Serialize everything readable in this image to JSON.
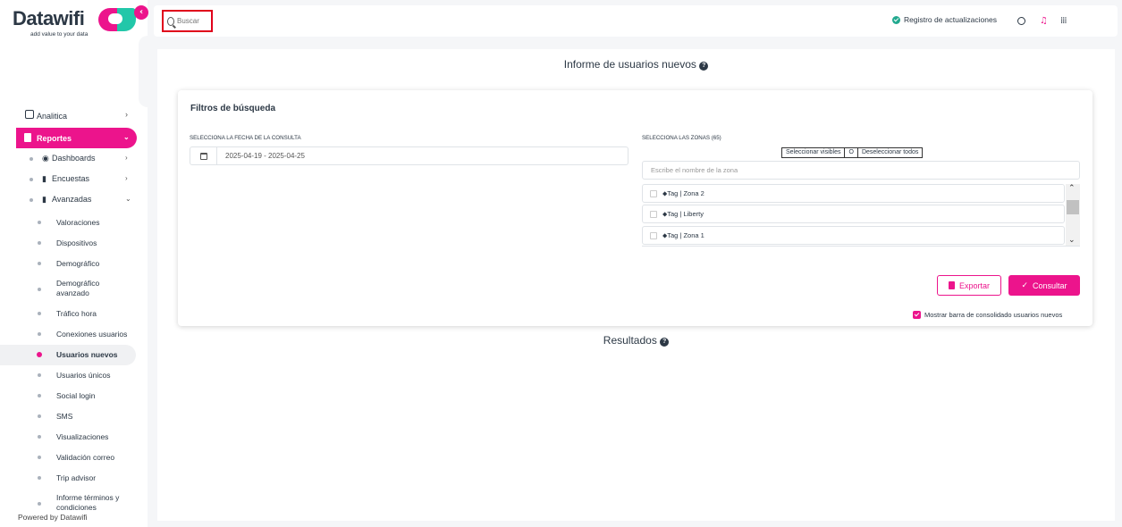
{
  "brand": {
    "name": "Datawifi",
    "tagline": "add value to your data",
    "accent": "#ec148c",
    "teal": "#22c7a9"
  },
  "topbar": {
    "search_placeholder": "Buscar",
    "updates_label": "Registro de actualizaciones",
    "icons": [
      "search-icon",
      "check-circle-icon",
      "globe-icon",
      "bell-icon",
      "apps-grid-icon"
    ]
  },
  "sidebar": {
    "collapse_icon": "chevron-left-icon",
    "top_items": [
      {
        "label": "Analitica",
        "icon": "chart-icon"
      }
    ],
    "reportes": {
      "label": "Reportes",
      "icon": "document-icon"
    },
    "sub_items": [
      {
        "label": "Dashboards",
        "icon": "dashboard-icon"
      },
      {
        "label": "Encuestas",
        "icon": "clipboard-icon"
      },
      {
        "label": "Avanzadas",
        "icon": "bars-icon"
      }
    ],
    "leaves": [
      "Valoraciones",
      "Dispositivos",
      "Demográfico",
      "Demográfico avanzado",
      "Tráfico hora",
      "Conexiones usuarios",
      "Usuarios nuevos",
      "Usuarios únicos",
      "Social login",
      "SMS",
      "Visualizaciones",
      "Validación correo",
      "Trip advisor",
      "Informe términos y condiciones"
    ],
    "current_leaf": "Usuarios nuevos",
    "footer": "Powered by Datawifi"
  },
  "main": {
    "title": "Informe de usuarios nuevos",
    "filters": {
      "title": "Filtros de búsqueda",
      "date_label": "SELECCIONA LA FECHA DE LA CONSULTA",
      "date_value": "2025-04-19 - 2025-04-25",
      "zones_label": "SELECCIONA LAS ZONAS (65)",
      "select_visible": "Seleccionar visibles",
      "separator": "O",
      "deselect_all": "Deseleccionar todos",
      "zone_search_placeholder": "Escribe el nombre de la zona",
      "zones": [
        "Tag | Zona 2",
        "Tag | Liberty",
        "Tag | Zona 1"
      ],
      "export_label": "Exportar",
      "consult_label": "Consultar",
      "consolidated_label": "Mostrar barra de consolidado usuarios nuevos",
      "consolidated_checked": true
    },
    "results_title": "Resultados"
  }
}
